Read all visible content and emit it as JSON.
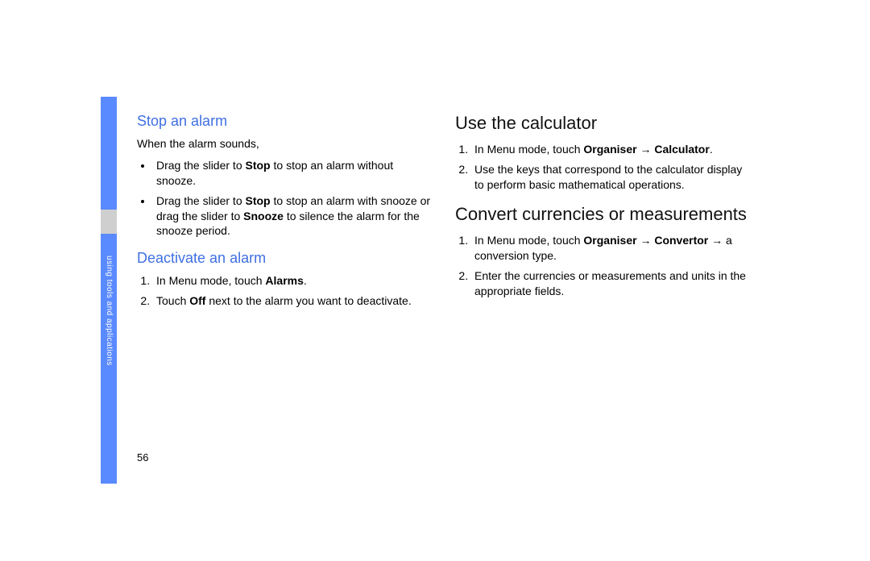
{
  "sidebar": {
    "label": "using tools and applications"
  },
  "page_number": "56",
  "left_column": {
    "section1": {
      "heading": "Stop an alarm",
      "intro": "When the alarm sounds,",
      "bullets": [
        {
          "pre": "Drag the slider to ",
          "bold1": "Stop",
          "mid": " to stop an alarm without snooze.",
          "bold2": "",
          "tail": ""
        },
        {
          "pre": "Drag the slider to ",
          "bold1": "Stop",
          "mid": " to stop an alarm with snooze or drag the slider to ",
          "bold2": "Snooze",
          "tail": " to silence the alarm for the snooze period."
        }
      ]
    },
    "section2": {
      "heading": "Deactivate an alarm",
      "steps": [
        {
          "pre": "In Menu mode, touch ",
          "bold1": "Alarms",
          "mid": ".",
          "bold2": "",
          "tail": ""
        },
        {
          "pre": "Touch ",
          "bold1": "Off",
          "mid": " next to the alarm you want to deactivate.",
          "bold2": "",
          "tail": ""
        }
      ]
    }
  },
  "right_column": {
    "section1": {
      "heading": "Use the calculator",
      "steps": [
        {
          "pre": "In Menu mode, touch ",
          "bold1": "Organiser",
          "mid": " → ",
          "bold2": "Calculator",
          "tail": "."
        },
        {
          "pre": "Use the keys that correspond to the calculator display to perform basic mathematical operations.",
          "bold1": "",
          "mid": "",
          "bold2": "",
          "tail": ""
        }
      ]
    },
    "section2": {
      "heading": "Convert currencies or measurements",
      "steps": [
        {
          "pre": "In Menu mode, touch ",
          "bold1": "Organiser",
          "mid": " → ",
          "bold2": "Convertor",
          "tail": " → a conversion type."
        },
        {
          "pre": "Enter the currencies or measurements and units in the appropriate fields.",
          "bold1": "",
          "mid": "",
          "bold2": "",
          "tail": ""
        }
      ]
    }
  }
}
